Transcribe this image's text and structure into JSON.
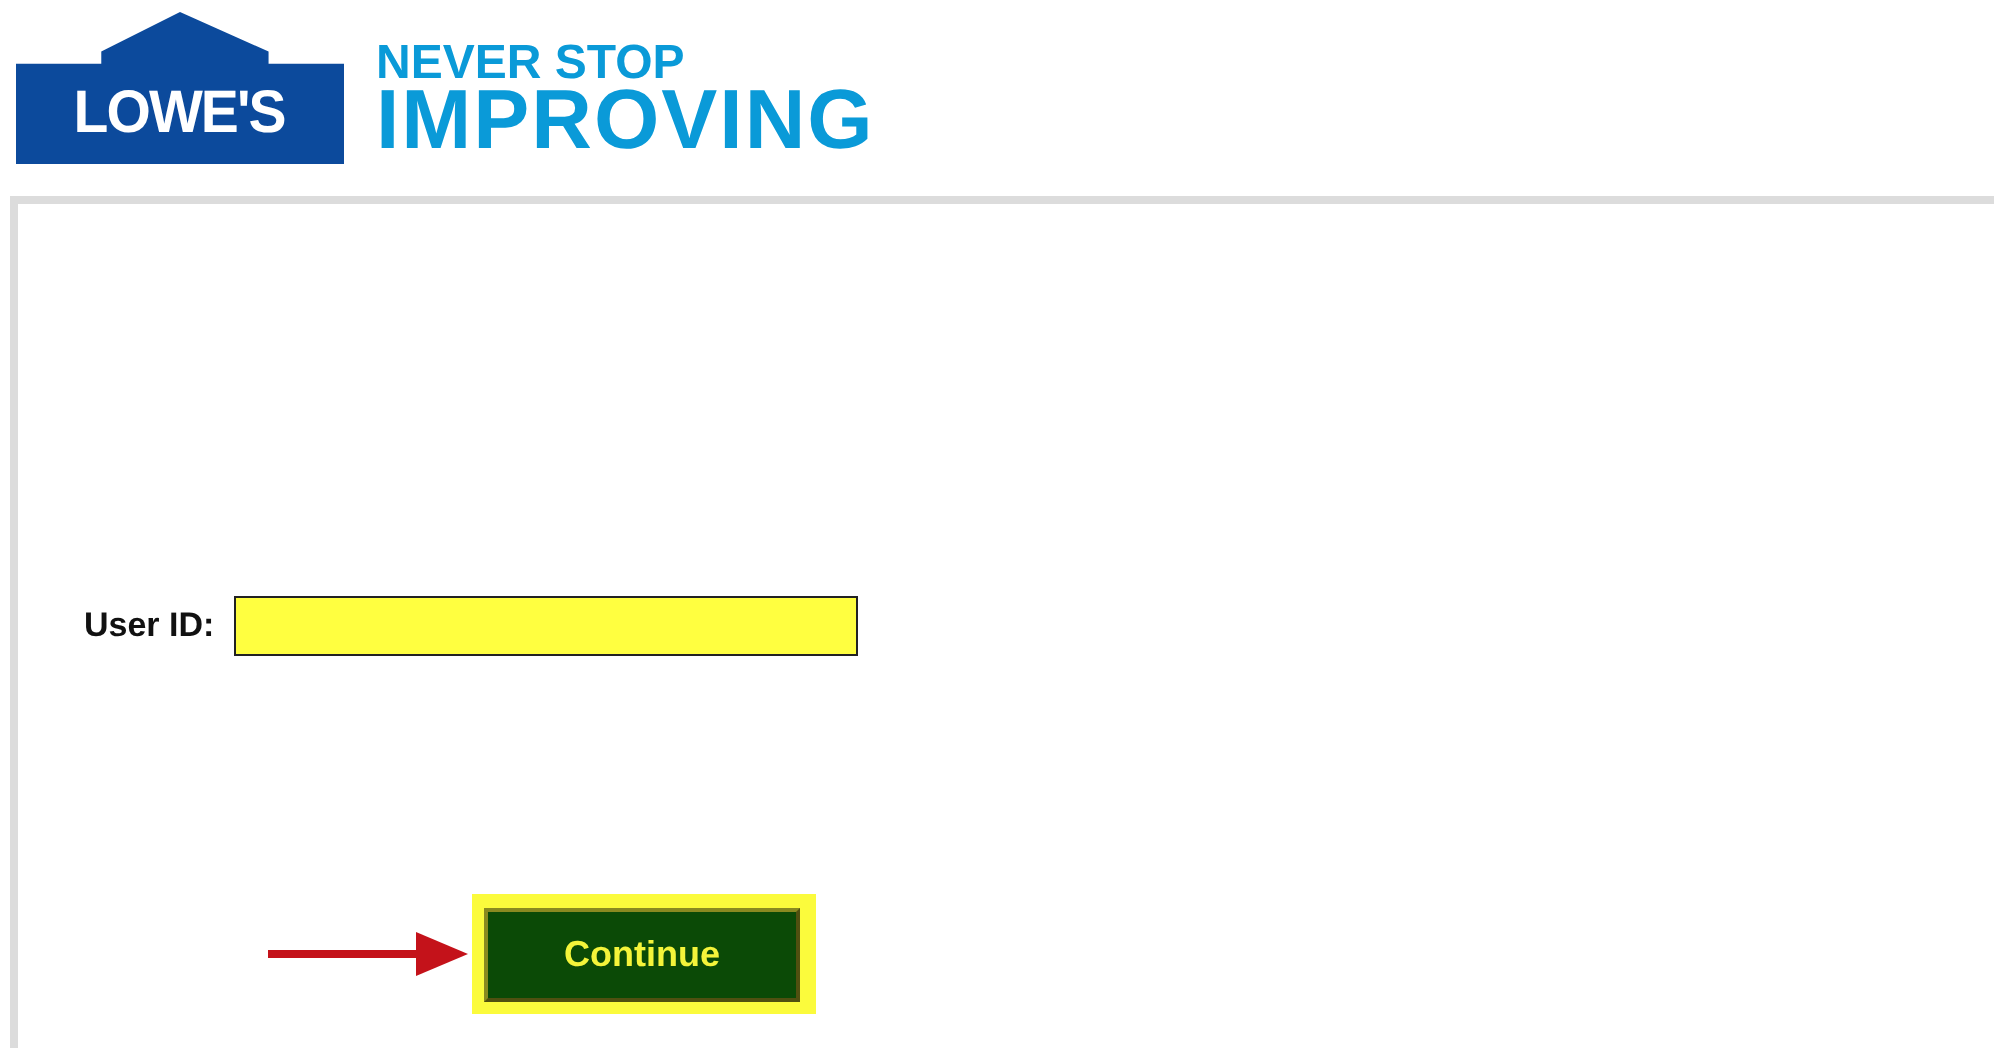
{
  "logo": {
    "brand": "LOWE'S",
    "tagline_top": "NEVER STOP",
    "tagline_bottom": "IMPROVING"
  },
  "form": {
    "label": "User ID:",
    "button": "Continue",
    "button_highlighted": true,
    "arrow": true
  }
}
